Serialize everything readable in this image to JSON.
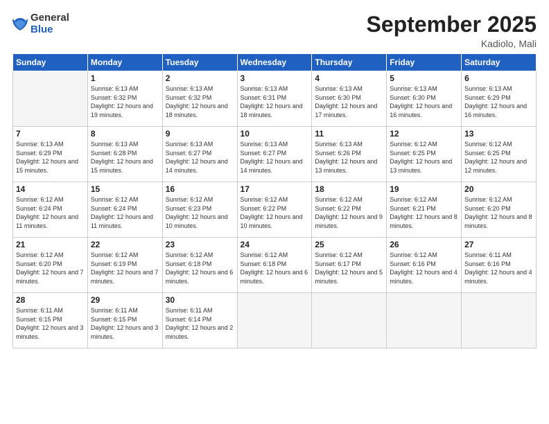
{
  "logo": {
    "general": "General",
    "blue": "Blue"
  },
  "title": "September 2025",
  "location": "Kadiolo, Mali",
  "days_header": [
    "Sunday",
    "Monday",
    "Tuesday",
    "Wednesday",
    "Thursday",
    "Friday",
    "Saturday"
  ],
  "weeks": [
    [
      {
        "num": "",
        "sunrise": "",
        "sunset": "",
        "daylight": ""
      },
      {
        "num": "1",
        "sunrise": "Sunrise: 6:13 AM",
        "sunset": "Sunset: 6:32 PM",
        "daylight": "Daylight: 12 hours and 19 minutes."
      },
      {
        "num": "2",
        "sunrise": "Sunrise: 6:13 AM",
        "sunset": "Sunset: 6:32 PM",
        "daylight": "Daylight: 12 hours and 18 minutes."
      },
      {
        "num": "3",
        "sunrise": "Sunrise: 6:13 AM",
        "sunset": "Sunset: 6:31 PM",
        "daylight": "Daylight: 12 hours and 18 minutes."
      },
      {
        "num": "4",
        "sunrise": "Sunrise: 6:13 AM",
        "sunset": "Sunset: 6:30 PM",
        "daylight": "Daylight: 12 hours and 17 minutes."
      },
      {
        "num": "5",
        "sunrise": "Sunrise: 6:13 AM",
        "sunset": "Sunset: 6:30 PM",
        "daylight": "Daylight: 12 hours and 16 minutes."
      },
      {
        "num": "6",
        "sunrise": "Sunrise: 6:13 AM",
        "sunset": "Sunset: 6:29 PM",
        "daylight": "Daylight: 12 hours and 16 minutes."
      }
    ],
    [
      {
        "num": "7",
        "sunrise": "Sunrise: 6:13 AM",
        "sunset": "Sunset: 6:29 PM",
        "daylight": "Daylight: 12 hours and 15 minutes."
      },
      {
        "num": "8",
        "sunrise": "Sunrise: 6:13 AM",
        "sunset": "Sunset: 6:28 PM",
        "daylight": "Daylight: 12 hours and 15 minutes."
      },
      {
        "num": "9",
        "sunrise": "Sunrise: 6:13 AM",
        "sunset": "Sunset: 6:27 PM",
        "daylight": "Daylight: 12 hours and 14 minutes."
      },
      {
        "num": "10",
        "sunrise": "Sunrise: 6:13 AM",
        "sunset": "Sunset: 6:27 PM",
        "daylight": "Daylight: 12 hours and 14 minutes."
      },
      {
        "num": "11",
        "sunrise": "Sunrise: 6:13 AM",
        "sunset": "Sunset: 6:26 PM",
        "daylight": "Daylight: 12 hours and 13 minutes."
      },
      {
        "num": "12",
        "sunrise": "Sunrise: 6:12 AM",
        "sunset": "Sunset: 6:25 PM",
        "daylight": "Daylight: 12 hours and 13 minutes."
      },
      {
        "num": "13",
        "sunrise": "Sunrise: 6:12 AM",
        "sunset": "Sunset: 6:25 PM",
        "daylight": "Daylight: 12 hours and 12 minutes."
      }
    ],
    [
      {
        "num": "14",
        "sunrise": "Sunrise: 6:12 AM",
        "sunset": "Sunset: 6:24 PM",
        "daylight": "Daylight: 12 hours and 11 minutes."
      },
      {
        "num": "15",
        "sunrise": "Sunrise: 6:12 AM",
        "sunset": "Sunset: 6:24 PM",
        "daylight": "Daylight: 12 hours and 11 minutes."
      },
      {
        "num": "16",
        "sunrise": "Sunrise: 6:12 AM",
        "sunset": "Sunset: 6:23 PM",
        "daylight": "Daylight: 12 hours and 10 minutes."
      },
      {
        "num": "17",
        "sunrise": "Sunrise: 6:12 AM",
        "sunset": "Sunset: 6:22 PM",
        "daylight": "Daylight: 12 hours and 10 minutes."
      },
      {
        "num": "18",
        "sunrise": "Sunrise: 6:12 AM",
        "sunset": "Sunset: 6:22 PM",
        "daylight": "Daylight: 12 hours and 9 minutes."
      },
      {
        "num": "19",
        "sunrise": "Sunrise: 6:12 AM",
        "sunset": "Sunset: 6:21 PM",
        "daylight": "Daylight: 12 hours and 8 minutes."
      },
      {
        "num": "20",
        "sunrise": "Sunrise: 6:12 AM",
        "sunset": "Sunset: 6:20 PM",
        "daylight": "Daylight: 12 hours and 8 minutes."
      }
    ],
    [
      {
        "num": "21",
        "sunrise": "Sunrise: 6:12 AM",
        "sunset": "Sunset: 6:20 PM",
        "daylight": "Daylight: 12 hours and 7 minutes."
      },
      {
        "num": "22",
        "sunrise": "Sunrise: 6:12 AM",
        "sunset": "Sunset: 6:19 PM",
        "daylight": "Daylight: 12 hours and 7 minutes."
      },
      {
        "num": "23",
        "sunrise": "Sunrise: 6:12 AM",
        "sunset": "Sunset: 6:18 PM",
        "daylight": "Daylight: 12 hours and 6 minutes."
      },
      {
        "num": "24",
        "sunrise": "Sunrise: 6:12 AM",
        "sunset": "Sunset: 6:18 PM",
        "daylight": "Daylight: 12 hours and 6 minutes."
      },
      {
        "num": "25",
        "sunrise": "Sunrise: 6:12 AM",
        "sunset": "Sunset: 6:17 PM",
        "daylight": "Daylight: 12 hours and 5 minutes."
      },
      {
        "num": "26",
        "sunrise": "Sunrise: 6:12 AM",
        "sunset": "Sunset: 6:16 PM",
        "daylight": "Daylight: 12 hours and 4 minutes."
      },
      {
        "num": "27",
        "sunrise": "Sunrise: 6:11 AM",
        "sunset": "Sunset: 6:16 PM",
        "daylight": "Daylight: 12 hours and 4 minutes."
      }
    ],
    [
      {
        "num": "28",
        "sunrise": "Sunrise: 6:11 AM",
        "sunset": "Sunset: 6:15 PM",
        "daylight": "Daylight: 12 hours and 3 minutes."
      },
      {
        "num": "29",
        "sunrise": "Sunrise: 6:11 AM",
        "sunset": "Sunset: 6:15 PM",
        "daylight": "Daylight: 12 hours and 3 minutes."
      },
      {
        "num": "30",
        "sunrise": "Sunrise: 6:11 AM",
        "sunset": "Sunset: 6:14 PM",
        "daylight": "Daylight: 12 hours and 2 minutes."
      },
      {
        "num": "",
        "sunrise": "",
        "sunset": "",
        "daylight": ""
      },
      {
        "num": "",
        "sunrise": "",
        "sunset": "",
        "daylight": ""
      },
      {
        "num": "",
        "sunrise": "",
        "sunset": "",
        "daylight": ""
      },
      {
        "num": "",
        "sunrise": "",
        "sunset": "",
        "daylight": ""
      }
    ]
  ]
}
